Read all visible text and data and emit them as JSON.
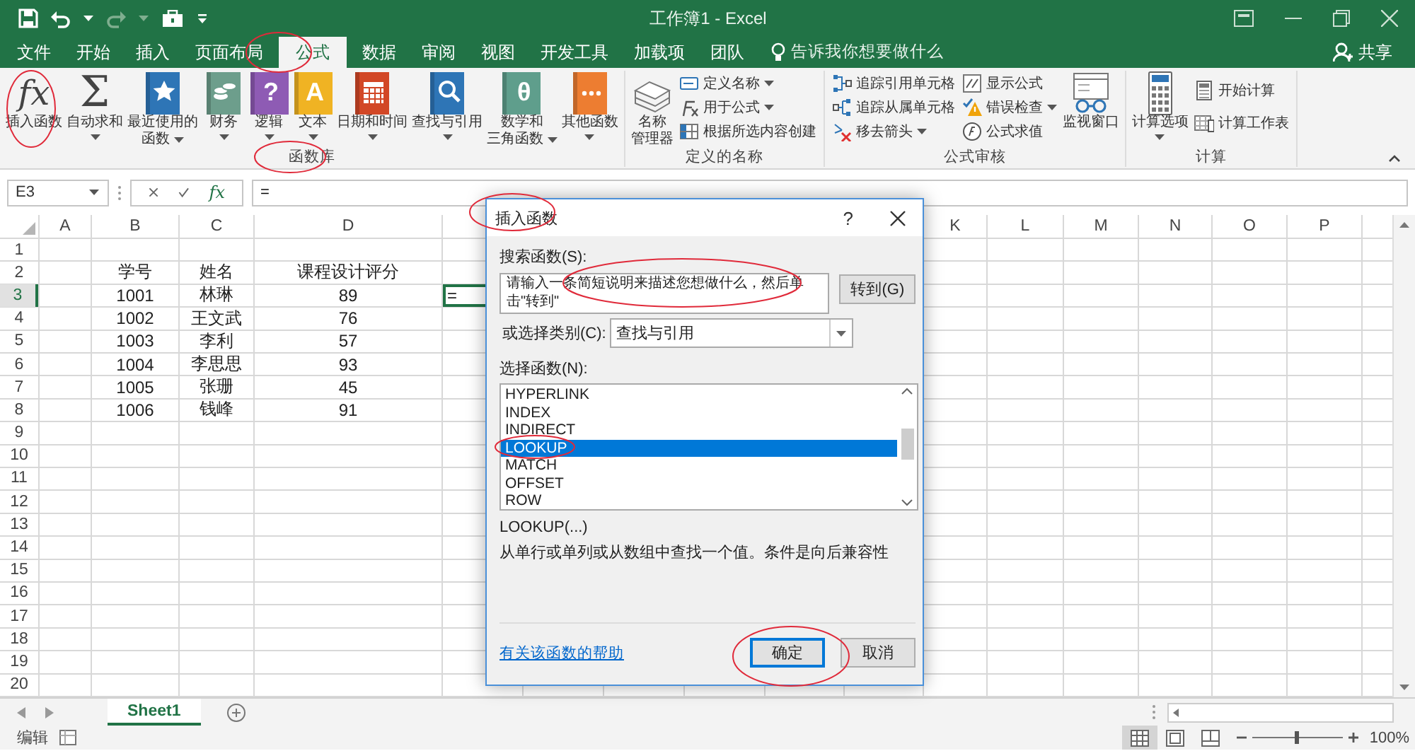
{
  "title_bar": {
    "title": "工作簿1 - Excel"
  },
  "tabs": [
    {
      "label": "文件",
      "selected": false
    },
    {
      "label": "开始",
      "selected": false
    },
    {
      "label": "插入",
      "selected": false
    },
    {
      "label": "页面布局",
      "selected": false
    },
    {
      "label": "公式",
      "selected": true
    },
    {
      "label": "数据",
      "selected": false
    },
    {
      "label": "审阅",
      "selected": false
    },
    {
      "label": "视图",
      "selected": false
    },
    {
      "label": "开发工具",
      "selected": false
    },
    {
      "label": "加载项",
      "selected": false
    },
    {
      "label": "团队",
      "selected": false
    }
  ],
  "tell_me": {
    "placeholder": "告诉我你想要做什么"
  },
  "share": {
    "label": "共享"
  },
  "ribbon": {
    "groups": [
      {
        "label": "函数库",
        "items": [
          {
            "kind": "large",
            "lines": [
              "插入函数"
            ],
            "glyph": "fx",
            "dropdown": false
          },
          {
            "kind": "large",
            "lines": [
              "自动求和"
            ],
            "glyph": "Σ",
            "dropdown": true
          },
          {
            "kind": "large",
            "lines": [
              "最近使用的",
              "函数"
            ],
            "dropdown": true
          },
          {
            "kind": "large",
            "lines": [
              "财务"
            ],
            "dropdown": true
          },
          {
            "kind": "large",
            "lines": [
              "逻辑"
            ],
            "glyph": "?",
            "dropdown": true
          },
          {
            "kind": "large",
            "lines": [
              "文本"
            ],
            "glyph": "A",
            "dropdown": true
          },
          {
            "kind": "large",
            "lines": [
              "日期和时间"
            ],
            "dropdown": true
          },
          {
            "kind": "large",
            "lines": [
              "查找与引用"
            ],
            "dropdown": true
          },
          {
            "kind": "large",
            "lines": [
              "数学和",
              "三角函数"
            ],
            "glyph": "θ",
            "dropdown": true
          },
          {
            "kind": "large",
            "lines": [
              "其他函数"
            ],
            "dropdown": true
          }
        ]
      },
      {
        "label": "定义的名称",
        "items": [
          {
            "kind": "large",
            "lines": [
              "名称",
              "管理器"
            ],
            "dropdown": false
          },
          {
            "kind": "small",
            "lines": [
              "定义名称"
            ],
            "dropdown": true
          },
          {
            "kind": "small",
            "lines": [
              "用于公式"
            ],
            "dropdown": true
          },
          {
            "kind": "small",
            "lines": [
              "根据所选内容创建"
            ],
            "dropdown": false
          }
        ]
      },
      {
        "label": "公式审核",
        "items": [
          {
            "kind": "small",
            "lines": [
              "追踪引用单元格"
            ],
            "dropdown": false
          },
          {
            "kind": "small",
            "lines": [
              "追踪从属单元格"
            ],
            "dropdown": false
          },
          {
            "kind": "small",
            "lines": [
              "移去箭头"
            ],
            "dropdown": true
          },
          {
            "kind": "small",
            "lines": [
              "显示公式"
            ],
            "dropdown": false
          },
          {
            "kind": "small",
            "lines": [
              "错误检查"
            ],
            "dropdown": true
          },
          {
            "kind": "small",
            "lines": [
              "公式求值"
            ],
            "dropdown": false
          },
          {
            "kind": "large",
            "lines": [
              "监视窗口"
            ],
            "dropdown": false
          }
        ]
      },
      {
        "label": "计算",
        "items": [
          {
            "kind": "large",
            "lines": [
              "计算选项"
            ],
            "dropdown": true
          },
          {
            "kind": "small",
            "lines": [
              "开始计算"
            ],
            "dropdown": false
          },
          {
            "kind": "small",
            "lines": [
              "计算工作表"
            ],
            "dropdown": false
          }
        ]
      }
    ]
  },
  "formula_bar": {
    "name_box": "E3",
    "fx_glyph": "fx",
    "formula": "="
  },
  "sheet": {
    "columns": [
      "A",
      "B",
      "C",
      "D",
      "K",
      "L",
      "M",
      "N",
      "O",
      "P"
    ],
    "rows": [
      {
        "number": "1",
        "selected": false
      },
      {
        "number": "2",
        "selected": false,
        "cells": [
          {
            "text": "学号",
            "selected": false
          },
          {
            "text": "姓名",
            "selected": false
          },
          {
            "text": "课程设计评分",
            "selected": false
          }
        ]
      },
      {
        "number": "3",
        "selected": true,
        "cells": [
          {
            "text": "1001",
            "selected": false
          },
          {
            "text": "林琳",
            "selected": false
          },
          {
            "text": "89",
            "selected": false
          },
          {
            "text": "=",
            "selected": true
          }
        ]
      },
      {
        "number": "4",
        "selected": false,
        "cells": [
          {
            "text": "1002",
            "selected": false
          },
          {
            "text": "王文武",
            "selected": false
          },
          {
            "text": "76",
            "selected": false
          }
        ]
      },
      {
        "number": "5",
        "selected": false,
        "cells": [
          {
            "text": "1003",
            "selected": false
          },
          {
            "text": "李利",
            "selected": false
          },
          {
            "text": "57",
            "selected": false
          }
        ]
      },
      {
        "number": "6",
        "selected": false,
        "cells": [
          {
            "text": "1004",
            "selected": false
          },
          {
            "text": "李思思",
            "selected": false
          },
          {
            "text": "93",
            "selected": false
          }
        ]
      },
      {
        "number": "7",
        "selected": false,
        "cells": [
          {
            "text": "1005",
            "selected": false
          },
          {
            "text": "张珊",
            "selected": false
          },
          {
            "text": "45",
            "selected": false
          }
        ]
      },
      {
        "number": "8",
        "selected": false,
        "cells": [
          {
            "text": "1006",
            "selected": false
          },
          {
            "text": "钱峰",
            "selected": false
          },
          {
            "text": "91",
            "selected": false
          }
        ]
      },
      {
        "number": "9",
        "selected": false
      },
      {
        "number": "10",
        "selected": false
      },
      {
        "number": "11",
        "selected": false
      },
      {
        "number": "12",
        "selected": false
      },
      {
        "number": "13",
        "selected": false
      },
      {
        "number": "14",
        "selected": false
      },
      {
        "number": "15",
        "selected": false
      },
      {
        "number": "16",
        "selected": false
      },
      {
        "number": "17",
        "selected": false
      },
      {
        "number": "18",
        "selected": false
      },
      {
        "number": "19",
        "selected": false
      },
      {
        "number": "20",
        "selected": false
      }
    ]
  },
  "dialog": {
    "title": "插入函数",
    "help_glyph": "?",
    "search_label": "搜索函数(S):",
    "search_value": "请输入一条简短说明来描述您想做什么，然后单击\"转到\"",
    "go_button": "转到(G)",
    "category_label": "或选择类别(C):",
    "category_value": "查找与引用",
    "function_label": "选择函数(N):",
    "functions": [
      {
        "name": "HYPERLINK",
        "selected": false
      },
      {
        "name": "INDEX",
        "selected": false
      },
      {
        "name": "INDIRECT",
        "selected": false
      },
      {
        "name": "LOOKUP",
        "selected": true
      },
      {
        "name": "MATCH",
        "selected": false
      },
      {
        "name": "OFFSET",
        "selected": false
      },
      {
        "name": "ROW",
        "selected": false
      }
    ],
    "signature": "LOOKUP(...)",
    "description": "从单行或单列或从数组中查找一个值。条件是向后兼容性",
    "help_link": "有关该函数的帮助",
    "buttons": [
      {
        "label": "确定",
        "default": true
      },
      {
        "label": "取消",
        "default": false
      }
    ]
  },
  "sheet_tabs": [
    {
      "label": "Sheet1",
      "selected": true
    }
  ],
  "status_bar": {
    "mode": "编辑",
    "views": [
      {
        "selected": true
      },
      {
        "selected": false
      },
      {
        "selected": false
      }
    ],
    "zoom": {
      "level": 0.5,
      "reading": "100%"
    }
  }
}
